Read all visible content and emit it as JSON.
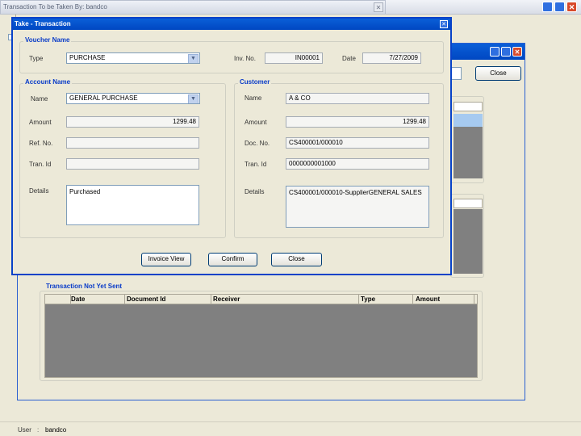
{
  "back_window": {
    "title": "Transaction To be Taken By: bandco"
  },
  "mid_window": {
    "close_label": "Close"
  },
  "dialog": {
    "title": "Take - Transaction",
    "voucher": {
      "group_label": "Voucher Name",
      "type_label": "Type",
      "type_value": "PURCHASE",
      "inv_no_label": "Inv. No.",
      "inv_no_value": "IN00001",
      "date_label": "Date",
      "date_value": "7/27/2009"
    },
    "account": {
      "group_label": "Account Name",
      "name_label": "Name",
      "name_value": "GENERAL PURCHASE",
      "amount_label": "Amount",
      "amount_value": "1299.48",
      "ref_no_label": "Ref. No.",
      "ref_no_value": "",
      "tran_id_label": "Tran. Id",
      "tran_id_value": "",
      "details_label": "Details",
      "details_value": "Purchased"
    },
    "customer": {
      "group_label": "Customer",
      "name_label": "Name",
      "name_value": "A & CO",
      "amount_label": "Amount",
      "amount_value": "1299.48",
      "doc_no_label": "Doc. No.",
      "doc_no_value": "CS400001/000010",
      "tran_id_label": "Tran. Id",
      "tran_id_value": "0000000001000",
      "details_label": "Details",
      "details_value": "CS400001/000010-SupplierGENERAL SALES"
    },
    "buttons": {
      "invoice_view": "Invoice View",
      "confirm": "Confirm",
      "close": "Close"
    }
  },
  "not_sent": {
    "group_label": "Transaction Not Yet Sent",
    "columns": [
      "Date",
      "Document Id",
      "Receiver",
      "Type",
      "Amount"
    ]
  },
  "status_bar": {
    "user_label": "User",
    "user_value": "bandco"
  },
  "colors": {
    "xp_title": "#0a5fd8",
    "group_legend": "#0a3cc8",
    "grid_body": "#808080",
    "selected_row": "#a6caf0"
  }
}
